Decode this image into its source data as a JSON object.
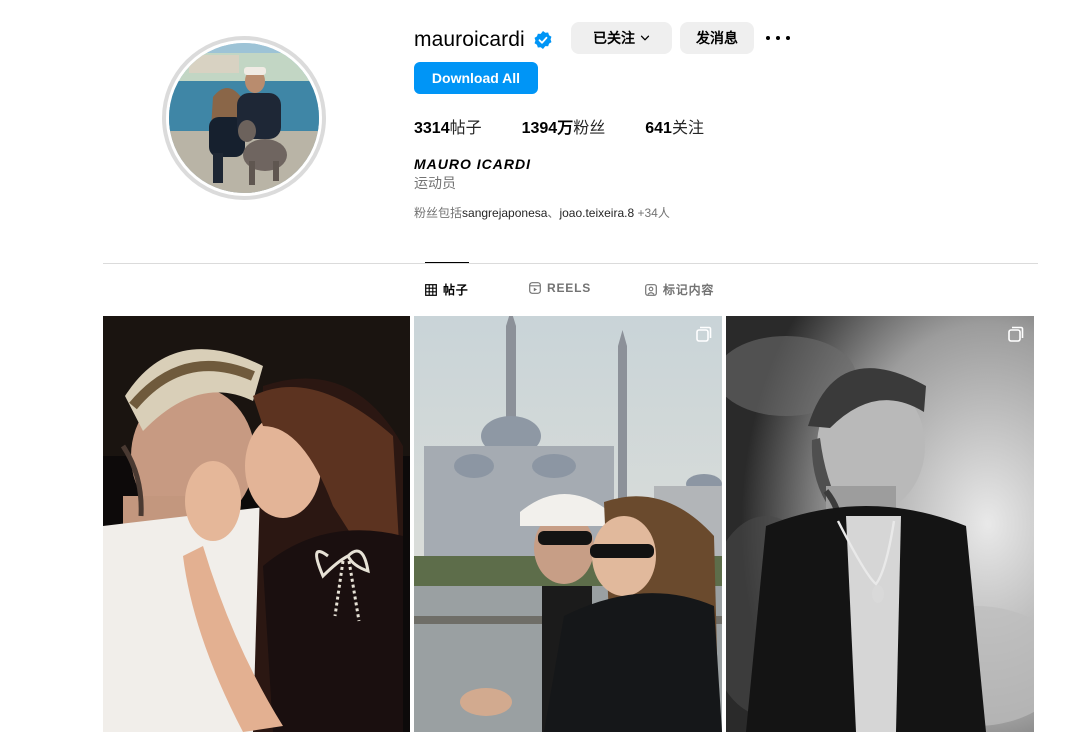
{
  "profile": {
    "username": "mauroicardi",
    "verified": true,
    "following_label": "已关注",
    "message_label": "发消息",
    "download_label": "Download All",
    "stats": {
      "posts_count": "3314",
      "posts_label": "帖子",
      "followers_count": "1394万",
      "followers_label": "粉丝",
      "following_count": "641",
      "following_label": "关注"
    },
    "full_name": "MAURO ICARDI",
    "category": "运动员",
    "followed_by": {
      "prefix": "粉丝包括",
      "name1": "sangrejaponesa",
      "separator": "、",
      "name2": "joao.teixeira.8",
      "more": " +34人"
    }
  },
  "tabs": [
    {
      "label": "帖子",
      "icon": "grid-icon",
      "active": true
    },
    {
      "label": "REELS",
      "icon": "reels-icon",
      "active": false
    },
    {
      "label": "标记内容",
      "icon": "tagged-icon",
      "active": false
    }
  ],
  "colors": {
    "accent": "#0095f6",
    "verified": "#0095f6",
    "button_bg": "#efefef",
    "divider": "#dbdbdb",
    "muted_text": "#737373"
  },
  "posts": [
    {
      "id": 1,
      "multi": false
    },
    {
      "id": 2,
      "multi": true
    },
    {
      "id": 3,
      "multi": true
    }
  ]
}
